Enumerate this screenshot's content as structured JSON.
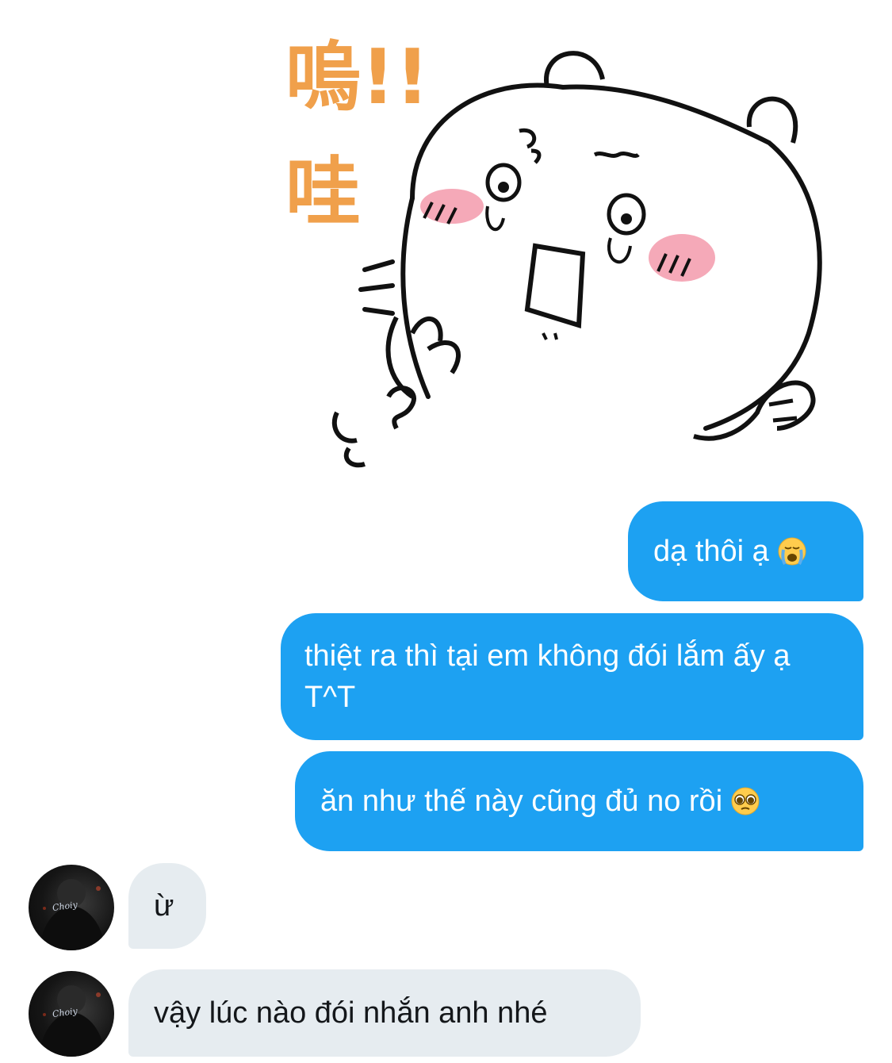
{
  "sticker": {
    "caption_top": "嗚!!",
    "caption_bottom": "哇"
  },
  "messages": [
    {
      "side": "outgoing",
      "text": "dạ thôi ạ",
      "emoji": "crying-face-icon"
    },
    {
      "side": "outgoing",
      "text": "thiệt ra thì tại em không đói lắm ấy ạ T^T"
    },
    {
      "side": "outgoing",
      "text": "ăn như thế này cũng đủ no rồi",
      "emoji": "pleading-face-icon"
    },
    {
      "side": "incoming",
      "text": "ừ"
    },
    {
      "side": "incoming",
      "text": "vậy lúc nào đói nhắn anh nhé"
    }
  ],
  "avatar": {
    "shirt_text": "Choiy"
  },
  "colors": {
    "outgoing_bubble": "#1da1f2",
    "incoming_bubble": "#e6ecf0",
    "sticker_text": "#f0a04b",
    "cheek": "#f5a9b8"
  }
}
